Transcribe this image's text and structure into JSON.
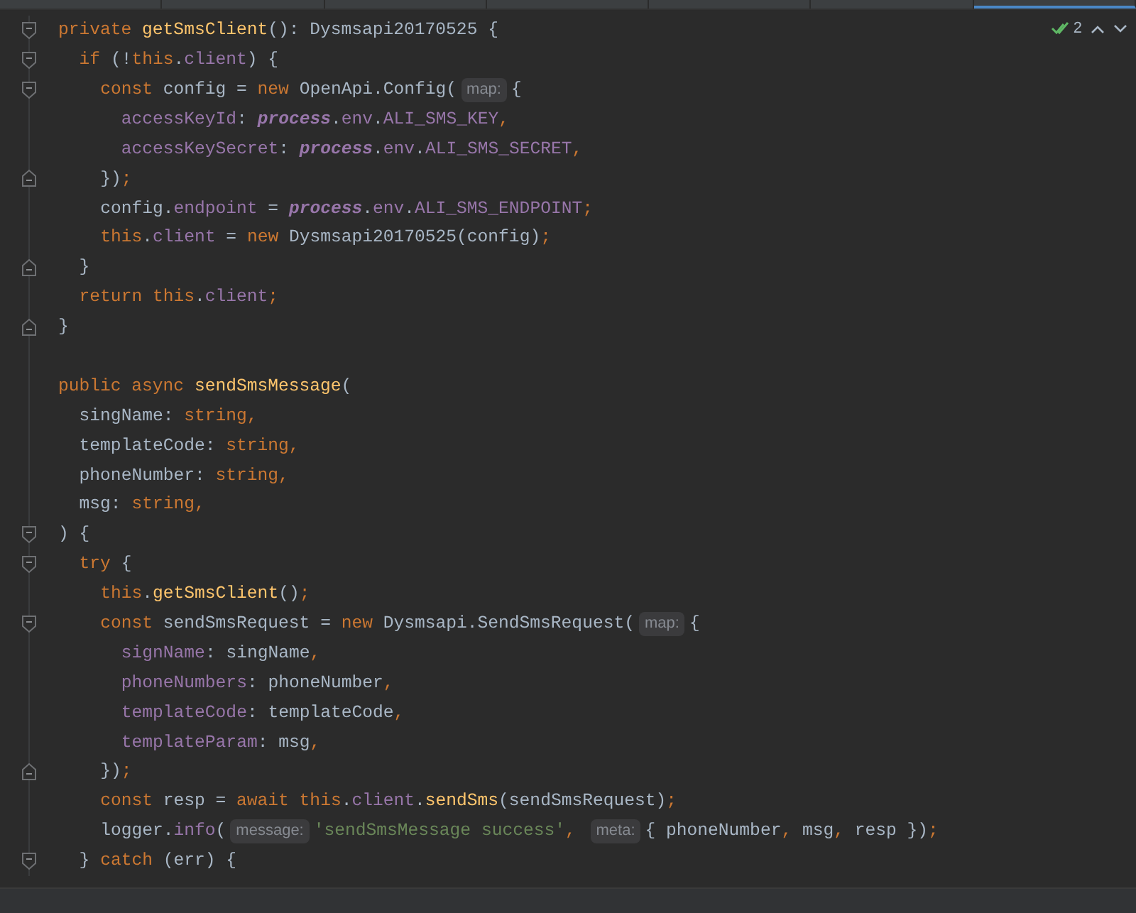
{
  "tabs": [
    {
      "selected": false
    },
    {
      "selected": false
    },
    {
      "selected": false
    },
    {
      "selected": false
    },
    {
      "selected": false
    },
    {
      "selected": false
    },
    {
      "selected": true
    }
  ],
  "inspections": {
    "count": "2"
  },
  "lines": [
    {
      "fold_start": true,
      "fold_end": false,
      "tokens": [
        {
          "kind": "kw",
          "text": "private "
        },
        {
          "kind": "fn",
          "text": "getSmsClient"
        },
        {
          "kind": "plain",
          "text": "(): Dysmsapi20170525 {"
        }
      ],
      "children": [
        {
          "fold_start": true,
          "fold_end": false,
          "tokens": [
            {
              "kind": "kw",
              "text": "if "
            },
            {
              "kind": "plain",
              "text": "(!"
            },
            {
              "kind": "kw",
              "text": "this"
            },
            {
              "kind": "plain",
              "text": "."
            },
            {
              "kind": "prop",
              "text": "client"
            },
            {
              "kind": "plain",
              "text": ") {"
            }
          ],
          "children": [
            {
              "fold_start": true,
              "fold_end": false,
              "tokens": [
                {
                  "kind": "kw",
                  "text": "const "
                },
                {
                  "kind": "plain",
                  "text": "config = "
                },
                {
                  "kind": "kw",
                  "text": "new "
                },
                {
                  "kind": "plain",
                  "text": "OpenApi.Config("
                },
                {
                  "kind": "hint",
                  "text": "map:"
                },
                {
                  "kind": "plain",
                  "text": "{"
                }
              ],
              "children": [
                {
                  "fold_start": false,
                  "fold_end": false,
                  "tokens": [
                    {
                      "kind": "prop",
                      "text": "accessKeyId"
                    },
                    {
                      "kind": "plain",
                      "text": ": "
                    },
                    {
                      "kind": "proc",
                      "text": "process"
                    },
                    {
                      "kind": "plain",
                      "text": "."
                    },
                    {
                      "kind": "prop",
                      "text": "env"
                    },
                    {
                      "kind": "plain",
                      "text": "."
                    },
                    {
                      "kind": "prop",
                      "text": "ALI_SMS_KEY"
                    },
                    {
                      "kind": "punct",
                      "text": ","
                    }
                  ]
                },
                {
                  "fold_start": false,
                  "fold_end": false,
                  "tokens": [
                    {
                      "kind": "prop",
                      "text": "accessKeySecret"
                    },
                    {
                      "kind": "plain",
                      "text": ": "
                    },
                    {
                      "kind": "proc",
                      "text": "process"
                    },
                    {
                      "kind": "plain",
                      "text": "."
                    },
                    {
                      "kind": "prop",
                      "text": "env"
                    },
                    {
                      "kind": "plain",
                      "text": "."
                    },
                    {
                      "kind": "prop",
                      "text": "ALI_SMS_SECRET"
                    },
                    {
                      "kind": "punct",
                      "text": ","
                    }
                  ]
                }
              ]
            },
            {
              "fold_start": false,
              "fold_end": true,
              "tokens": [
                {
                  "kind": "plain",
                  "text": "})"
                },
                {
                  "kind": "punct",
                  "text": ";"
                }
              ]
            },
            {
              "fold_start": false,
              "fold_end": false,
              "tokens": [
                {
                  "kind": "plain",
                  "text": "config."
                },
                {
                  "kind": "prop",
                  "text": "endpoint"
                },
                {
                  "kind": "plain",
                  "text": " = "
                },
                {
                  "kind": "proc",
                  "text": "process"
                },
                {
                  "kind": "plain",
                  "text": "."
                },
                {
                  "kind": "prop",
                  "text": "env"
                },
                {
                  "kind": "plain",
                  "text": "."
                },
                {
                  "kind": "prop",
                  "text": "ALI_SMS_ENDPOINT"
                },
                {
                  "kind": "punct",
                  "text": ";"
                }
              ]
            },
            {
              "fold_start": false,
              "fold_end": false,
              "tokens": [
                {
                  "kind": "kw",
                  "text": "this"
                },
                {
                  "kind": "plain",
                  "text": "."
                },
                {
                  "kind": "prop",
                  "text": "client"
                },
                {
                  "kind": "plain",
                  "text": " = "
                },
                {
                  "kind": "kw",
                  "text": "new "
                },
                {
                  "kind": "plain",
                  "text": "Dysmsapi20170525(config)"
                },
                {
                  "kind": "punct",
                  "text": ";"
                }
              ]
            }
          ]
        },
        {
          "fold_start": false,
          "fold_end": true,
          "tokens": [
            {
              "kind": "plain",
              "text": "}"
            }
          ]
        },
        {
          "fold_start": false,
          "fold_end": false,
          "tokens": [
            {
              "kind": "kw",
              "text": "return this"
            },
            {
              "kind": "plain",
              "text": "."
            },
            {
              "kind": "prop",
              "text": "client"
            },
            {
              "kind": "punct",
              "text": ";"
            }
          ]
        }
      ]
    },
    {
      "fold_start": false,
      "fold_end": true,
      "tokens": [
        {
          "kind": "plain",
          "text": "}"
        }
      ]
    },
    {
      "fold_start": false,
      "fold_end": false
    },
    {
      "fold_start": false,
      "fold_end": false,
      "tokens": [
        {
          "kind": "kw",
          "text": "public async "
        },
        {
          "kind": "fn",
          "text": "sendSmsMessage"
        },
        {
          "kind": "plain",
          "text": "("
        }
      ],
      "children": [
        {
          "fold_start": false,
          "fold_end": false,
          "tokens": [
            {
              "kind": "plain",
              "text": "singName: "
            },
            {
              "kind": "kw",
              "text": "string,"
            }
          ]
        },
        {
          "fold_start": false,
          "fold_end": false,
          "tokens": [
            {
              "kind": "plain",
              "text": "templateCode: "
            },
            {
              "kind": "kw",
              "text": "string,"
            }
          ]
        },
        {
          "fold_start": false,
          "fold_end": false,
          "tokens": [
            {
              "kind": "plain",
              "text": "phoneNumber: "
            },
            {
              "kind": "kw",
              "text": "string,"
            }
          ]
        },
        {
          "fold_start": false,
          "fold_end": false,
          "tokens": [
            {
              "kind": "plain",
              "text": "msg: "
            },
            {
              "kind": "kw",
              "text": "string,"
            }
          ]
        }
      ]
    },
    {
      "fold_start": true,
      "fold_end": false,
      "tokens": [
        {
          "kind": "plain",
          "text": ") {"
        }
      ],
      "children": [
        {
          "fold_start": true,
          "fold_end": false,
          "tokens": [
            {
              "kind": "kw",
              "text": "try "
            },
            {
              "kind": "plain",
              "text": "{"
            }
          ],
          "children": [
            {
              "fold_start": false,
              "fold_end": false,
              "tokens": [
                {
                  "kind": "kw",
                  "text": "this"
                },
                {
                  "kind": "plain",
                  "text": "."
                },
                {
                  "kind": "fn",
                  "text": "getSmsClient"
                },
                {
                  "kind": "plain",
                  "text": "()"
                },
                {
                  "kind": "punct",
                  "text": ";"
                }
              ]
            },
            {
              "fold_start": true,
              "fold_end": false,
              "tokens": [
                {
                  "kind": "kw",
                  "text": "const "
                },
                {
                  "kind": "plain",
                  "text": "sendSmsRequest = "
                },
                {
                  "kind": "kw",
                  "text": "new "
                },
                {
                  "kind": "plain",
                  "text": "Dysmsapi.SendSmsRequest("
                },
                {
                  "kind": "hint",
                  "text": "map:"
                },
                {
                  "kind": "plain",
                  "text": "{"
                }
              ],
              "children": [
                {
                  "fold_start": false,
                  "fold_end": false,
                  "tokens": [
                    {
                      "kind": "prop",
                      "text": "signName"
                    },
                    {
                      "kind": "plain",
                      "text": ": singName"
                    },
                    {
                      "kind": "punct",
                      "text": ","
                    }
                  ]
                },
                {
                  "fold_start": false,
                  "fold_end": false,
                  "tokens": [
                    {
                      "kind": "prop",
                      "text": "phoneNumbers"
                    },
                    {
                      "kind": "plain",
                      "text": ": phoneNumber"
                    },
                    {
                      "kind": "punct",
                      "text": ","
                    }
                  ]
                },
                {
                  "fold_start": false,
                  "fold_end": false,
                  "tokens": [
                    {
                      "kind": "prop",
                      "text": "templateCode"
                    },
                    {
                      "kind": "plain",
                      "text": ": templateCode"
                    },
                    {
                      "kind": "punct",
                      "text": ","
                    }
                  ]
                },
                {
                  "fold_start": false,
                  "fold_end": false,
                  "tokens": [
                    {
                      "kind": "prop",
                      "text": "templateParam"
                    },
                    {
                      "kind": "plain",
                      "text": ": msg"
                    },
                    {
                      "kind": "punct",
                      "text": ","
                    }
                  ]
                }
              ]
            },
            {
              "fold_start": false,
              "fold_end": true,
              "tokens": [
                {
                  "kind": "plain",
                  "text": "})"
                },
                {
                  "kind": "punct",
                  "text": ";"
                }
              ]
            },
            {
              "fold_start": false,
              "fold_end": false,
              "tokens": [
                {
                  "kind": "kw",
                  "text": "const "
                },
                {
                  "kind": "plain",
                  "text": "resp = "
                },
                {
                  "kind": "kw",
                  "text": "await this"
                },
                {
                  "kind": "plain",
                  "text": "."
                },
                {
                  "kind": "prop",
                  "text": "client"
                },
                {
                  "kind": "plain",
                  "text": "."
                },
                {
                  "kind": "fn",
                  "text": "sendSms"
                },
                {
                  "kind": "plain",
                  "text": "(sendSmsRequest)"
                },
                {
                  "kind": "punct",
                  "text": ";"
                }
              ]
            },
            {
              "fold_start": false,
              "fold_end": false,
              "tokens": [
                {
                  "kind": "plain",
                  "text": "logger."
                },
                {
                  "kind": "prop",
                  "text": "info"
                },
                {
                  "kind": "plain",
                  "text": "("
                },
                {
                  "kind": "hint",
                  "text": "message:"
                },
                {
                  "kind": "str",
                  "text": "'sendSmsMessage success'"
                },
                {
                  "kind": "punct",
                  "text": ", "
                },
                {
                  "kind": "hint",
                  "text": "meta:"
                },
                {
                  "kind": "plain",
                  "text": "{ phoneNumber"
                },
                {
                  "kind": "punct",
                  "text": ", "
                },
                {
                  "kind": "plain",
                  "text": "msg"
                },
                {
                  "kind": "punct",
                  "text": ", "
                },
                {
                  "kind": "plain",
                  "text": "resp })"
                },
                {
                  "kind": "punct",
                  "text": ";"
                }
              ]
            }
          ]
        },
        {
          "fold_start": true,
          "fold_end": false,
          "tokens": [
            {
              "kind": "plain",
              "text": "} "
            },
            {
              "kind": "kw",
              "text": "catch "
            },
            {
              "kind": "plain",
              "text": "(err) {"
            }
          ]
        }
      ]
    }
  ]
}
